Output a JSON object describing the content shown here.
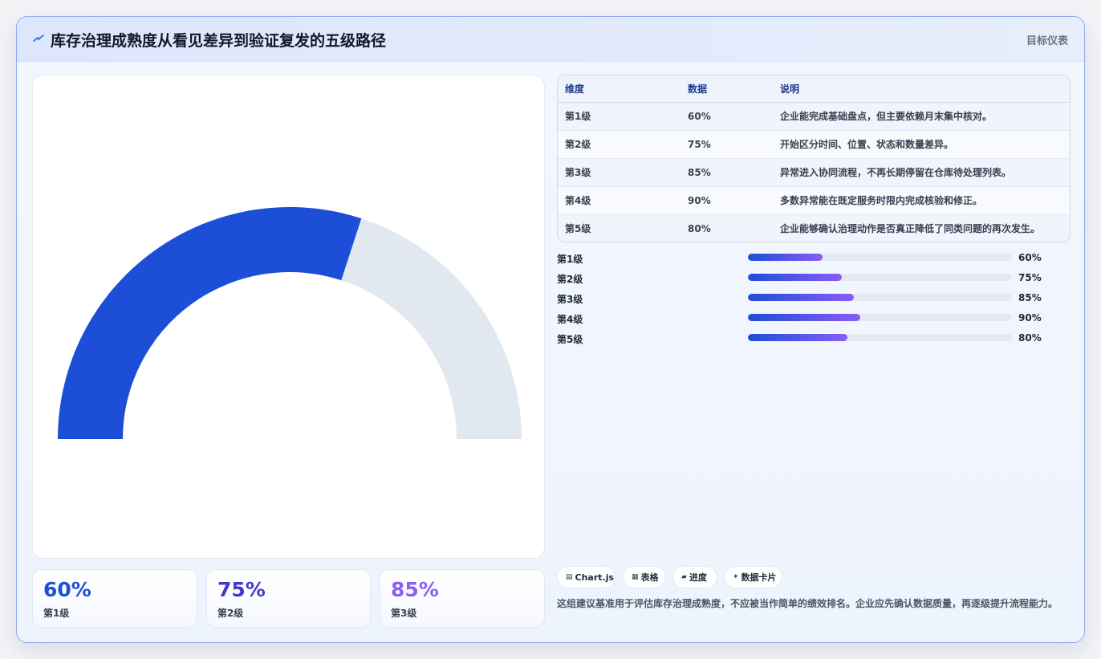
{
  "header": {
    "title": "库存治理成熟度从看见差异到验证复发的五级路径",
    "right_label": "目标仪表"
  },
  "colors": {
    "accent": "#1d4ed8",
    "track": "#e2e8f0",
    "stat1": "#1d4ed8",
    "stat2": "#4338ca",
    "stat3": "#8b5cf6"
  },
  "chart_data": {
    "type": "gauge",
    "value": 60,
    "max": 100,
    "level": "第1级"
  },
  "table": {
    "headers": [
      "维度",
      "数据",
      "说明"
    ],
    "rows": [
      {
        "dim": "第1级",
        "value": "60%",
        "desc": "企业能完成基础盘点，但主要依赖月末集中核对。"
      },
      {
        "dim": "第2级",
        "value": "75%",
        "desc": "开始区分时间、位置、状态和数量差异。"
      },
      {
        "dim": "第3级",
        "value": "85%",
        "desc": "异常进入协同流程，不再长期停留在仓库待处理列表。"
      },
      {
        "dim": "第4级",
        "value": "90%",
        "desc": "多数异常能在既定服务时限内完成核验和修正。"
      },
      {
        "dim": "第5级",
        "value": "80%",
        "desc": "企业能够确认治理动作是否真正降低了同类问题的再次发生。"
      }
    ]
  },
  "progress": [
    {
      "label": "第1级",
      "value": "60%",
      "fraction": 0.284
    },
    {
      "label": "第2级",
      "value": "75%",
      "fraction": 0.355
    },
    {
      "label": "第3级",
      "value": "85%",
      "fraction": 0.402
    },
    {
      "label": "第4级",
      "value": "90%",
      "fraction": 0.425
    },
    {
      "label": "第5级",
      "value": "80%",
      "fraction": 0.378
    }
  ],
  "stats": [
    {
      "value": "60%",
      "label": "第1级"
    },
    {
      "value": "75%",
      "label": "第2级"
    },
    {
      "value": "85%",
      "label": "第3级"
    }
  ],
  "chips": [
    {
      "icon": "chart-icon",
      "label": "Chart.js"
    },
    {
      "icon": "table-icon",
      "label": "表格"
    },
    {
      "icon": "progress-icon",
      "label": "进度"
    },
    {
      "icon": "sparkle-icon",
      "label": "数据卡片"
    }
  ],
  "note": "这组建议基准用于评估库存治理成熟度，不应被当作简单的绩效排名。企业应先确认数据质量，再逐级提升流程能力。"
}
